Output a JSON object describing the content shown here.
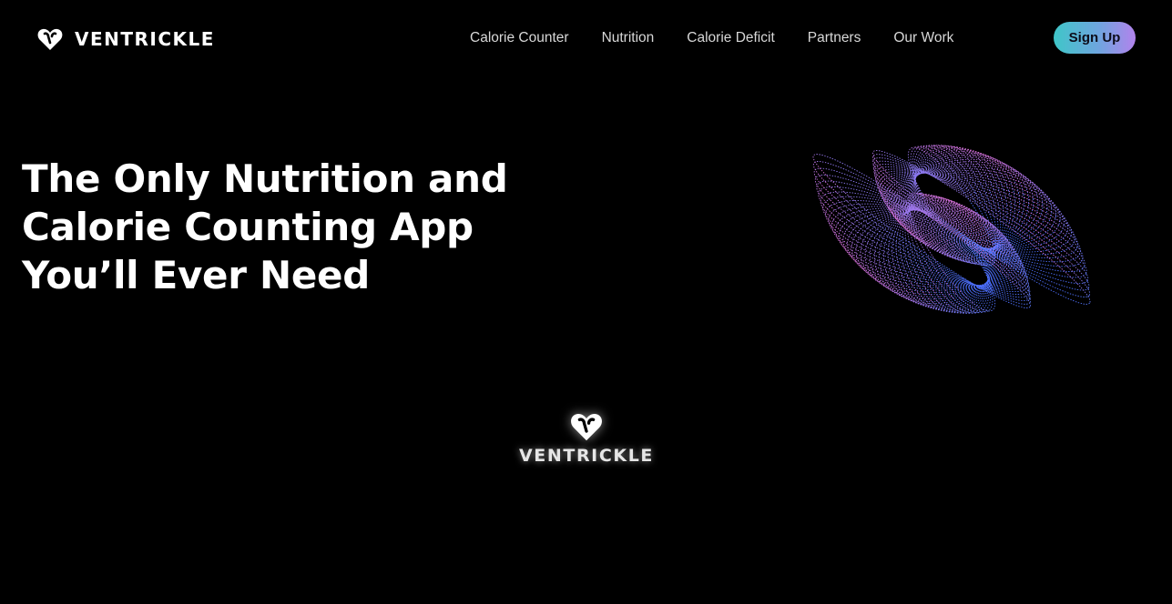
{
  "header": {
    "brand": "VENTRICKLE",
    "nav": [
      {
        "label": "Calorie Counter"
      },
      {
        "label": "Nutrition"
      },
      {
        "label": "Calorie Deficit"
      },
      {
        "label": "Partners"
      },
      {
        "label": "Our Work"
      }
    ],
    "signup_label": "Sign Up"
  },
  "hero": {
    "title_lines": [
      "The Only Nutrition and",
      "Calorie Counting App",
      "You’ll Ever Need"
    ]
  },
  "center_brand": {
    "text": "VENTRICKLE"
  },
  "colors": {
    "background": "#000000",
    "text": "#ffffff",
    "nav_text": "#d8d8d8",
    "signup_gradient_start": "#3fc6c8",
    "signup_gradient_end": "#b283ec",
    "art_pink": "#e070d8",
    "art_blue": "#5a7dff"
  },
  "icons": {
    "logo": "heart-logo-icon",
    "art": "spiral-wave-art"
  }
}
